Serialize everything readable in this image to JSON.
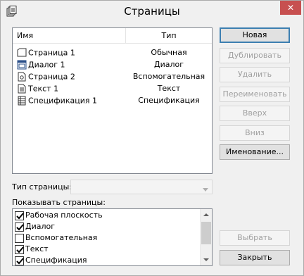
{
  "window": {
    "title": "Страницы",
    "close_glyph": "✕"
  },
  "pages_list": {
    "columns": {
      "name": "Имя",
      "type": "Тип"
    },
    "rows": [
      {
        "icon": "page-outline-icon",
        "name": "Страница 1",
        "type": "Обычная"
      },
      {
        "icon": "dialog-icon",
        "name": "Диалог 1",
        "type": "Диалог"
      },
      {
        "icon": "auxiliary-page-icon",
        "name": "Страница 2",
        "type": "Вспомогательная"
      },
      {
        "icon": "text-page-icon",
        "name": "Текст 1",
        "type": "Текст"
      },
      {
        "icon": "specification-icon",
        "name": "Спецификация 1",
        "type": "Спецификация"
      }
    ]
  },
  "buttons": {
    "new": "Новая",
    "duplicate": "Дублировать",
    "delete": "Удалить",
    "rename": "Переименовать",
    "up": "Вверх",
    "down": "Вниз",
    "naming": "Именование...",
    "select": "Выбрать",
    "close": "Закрыть"
  },
  "page_type": {
    "label": "Тип страницы:",
    "value": ""
  },
  "show_pages": {
    "label": "Показывать страницы:",
    "items": [
      {
        "label": "Рабочая плоскость",
        "checked": true
      },
      {
        "label": "Диалог",
        "checked": true
      },
      {
        "label": "Вспомогательная",
        "checked": false
      },
      {
        "label": "Текст",
        "checked": true
      },
      {
        "label": "Спецификация",
        "checked": true
      }
    ]
  }
}
